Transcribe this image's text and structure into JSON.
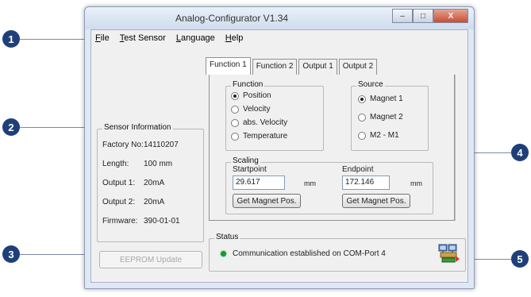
{
  "window": {
    "title": "Analog-Configurator V1.34",
    "minimize_symbol": "–",
    "maximize_symbol": "□",
    "close_symbol": "X"
  },
  "menu": [
    "File",
    "Test Sensor",
    "Language",
    "Help"
  ],
  "tabs": [
    "Function 1",
    "Function 2",
    "Output 1",
    "Output 2"
  ],
  "function_group": {
    "title": "Function",
    "options": [
      "Position",
      "Velocity",
      "abs. Velocity",
      "Temperature"
    ],
    "selected": "Position"
  },
  "source_group": {
    "title": "Source",
    "options": [
      "Magnet 1",
      "Magnet 2",
      "M2 - M1"
    ],
    "selected": "Magnet 1"
  },
  "scaling": {
    "title": "Scaling",
    "startpoint_label": "Startpoint",
    "startpoint_value": "29.617",
    "endpoint_label": "Endpoint",
    "endpoint_value": "172.146",
    "unit": "mm",
    "get_magnet_label": "Get Magnet Pos."
  },
  "sensor_info": {
    "title": "Sensor Information",
    "rows": [
      {
        "key": "Factory No:",
        "value": "14110207"
      },
      {
        "key": "Length:",
        "value": "100 mm"
      },
      {
        "key": "Output 1:",
        "value": "20mA"
      },
      {
        "key": "Output 2:",
        "value": "20mA"
      },
      {
        "key": "Firmware:",
        "value": "390-01-01"
      }
    ]
  },
  "eeprom_button": "EEPROM Update",
  "status": {
    "title": "Status",
    "message": "Communication established on COM-Port 4",
    "dot_color": "#1a9a2a",
    "icon": "network-connection-icon"
  },
  "callouts": [
    "1",
    "2",
    "3",
    "4",
    "5"
  ]
}
